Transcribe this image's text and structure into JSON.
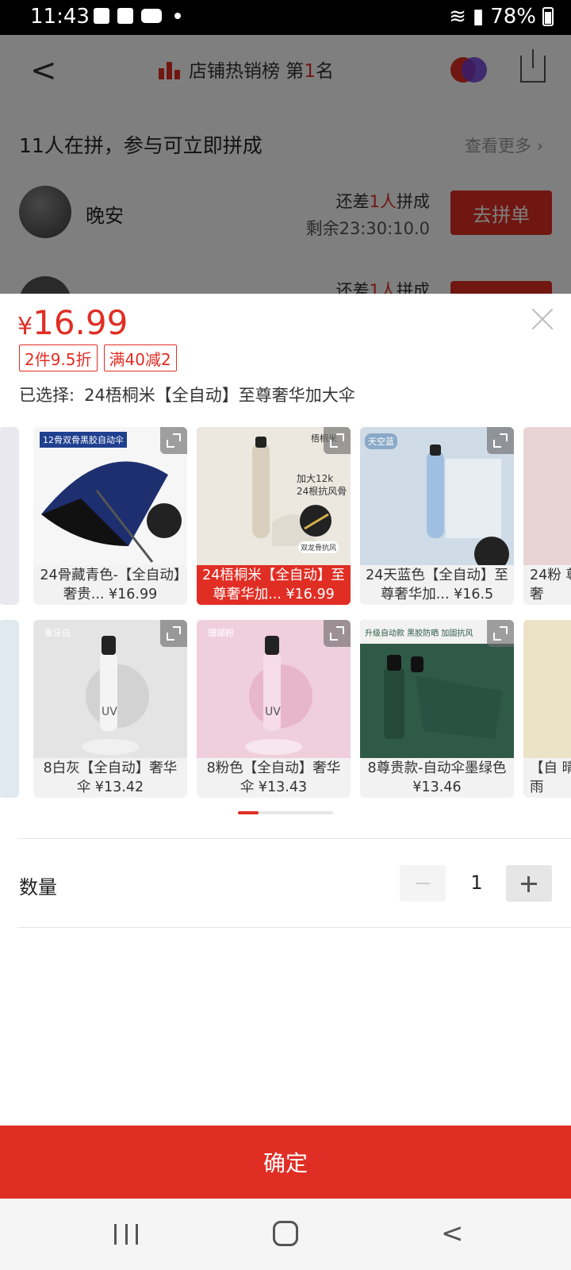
{
  "status_bar": {
    "time": "11:43",
    "battery": "78%"
  },
  "header": {
    "rank_prefix": "店铺热销榜 第",
    "rank_number": "1",
    "rank_suffix": "名"
  },
  "group_buy": {
    "title": "11人在拼，参与可立即拼成",
    "see_more": "查看更多",
    "row": {
      "name": "晚安",
      "need_prefix": "还差",
      "need_count": "1人",
      "need_suffix": "拼成",
      "remaining": "剩余23:30:10.0",
      "button": "去拼单"
    },
    "row2": {
      "need_prefix": "还差",
      "need_count": "1人",
      "need_suffix": "拼成"
    }
  },
  "sheet": {
    "currency": "¥",
    "price": "16.99",
    "tags": [
      "2件9.5折",
      "满40减2"
    ],
    "selected_label": "已选择:",
    "selected_value": "24梧桐米【全自动】至尊奢华加大伞",
    "variants": [
      {
        "caption": "24骨藏青色-【全自动】奢贵... ¥16.99",
        "selected": false,
        "img_text": "12骨双骨黑胶自动伞"
      },
      {
        "caption": "24梧桐米【全自动】至尊奢华加... ¥16.99",
        "selected": true,
        "img_text": "梧桐米"
      },
      {
        "caption": "24天蓝色【全自动】至尊奢华加... ¥16.5",
        "selected": false,
        "img_text": "天空蓝"
      },
      {
        "caption": "24粉 尊奢",
        "selected": false
      },
      {
        "caption": "8白灰【全自动】奢华伞 ¥13.42",
        "selected": false,
        "img_text": "象牙白"
      },
      {
        "caption": "8粉色【全自动】奢华伞 ¥13.43",
        "selected": false,
        "img_text": "珊瑚粉"
      },
      {
        "caption": "8尊贵款-自动伞墨绿色 ¥13.46",
        "selected": false,
        "img_text": "升级自动款 黑胶防晒 加固抗风"
      },
      {
        "caption": "【自 晴雨",
        "selected": false
      }
    ],
    "img_texts": {
      "v2_line1": "加大12k",
      "v2_line2": "24根抗风骨",
      "v2_badge": "双龙骨抗风",
      "uv": "UV"
    },
    "quantity_label": "数量",
    "quantity": "1",
    "confirm": "确定"
  },
  "colors": {
    "accent": "#e02e24"
  }
}
